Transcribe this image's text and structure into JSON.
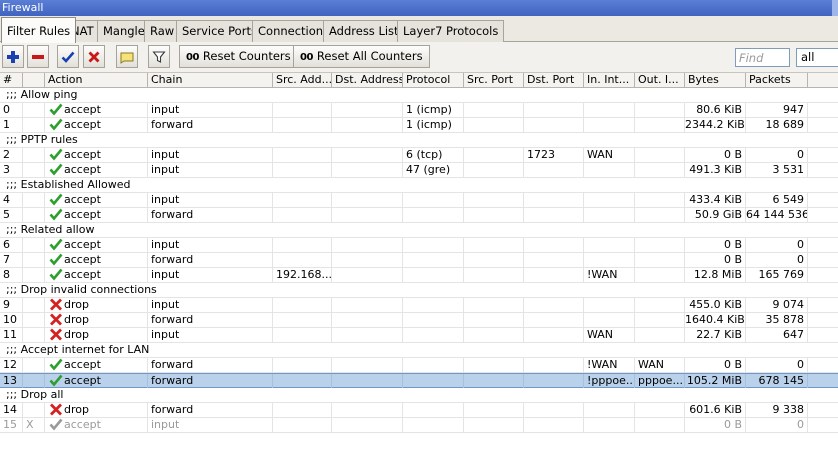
{
  "window": {
    "title": "Firewall"
  },
  "tabs": [
    {
      "label": "Filter Rules",
      "active": true
    },
    {
      "label": "NAT"
    },
    {
      "label": "Mangle"
    },
    {
      "label": "Raw"
    },
    {
      "label": "Service Ports"
    },
    {
      "label": "Connections"
    },
    {
      "label": "Address Lists"
    },
    {
      "label": "Layer7 Protocols"
    }
  ],
  "toolbar": {
    "add_icon": "plus-icon",
    "remove_icon": "minus-icon",
    "enable_icon": "checkmark-icon",
    "disable_icon": "x-icon",
    "comment_icon": "note-icon",
    "filter_icon": "funnel-icon",
    "reset_counters_label": "Reset Counters",
    "reset_all_counters_label": "Reset All Counters",
    "counter_prefix": "00",
    "find_placeholder": "Find",
    "filter_value": "all"
  },
  "columns": [
    "#",
    "",
    "Action",
    "Chain",
    "Src. Add...",
    "Dst. Address",
    "Protocol",
    "Src. Port",
    "Dst. Port",
    "In. Int...",
    "Out. I...",
    "Bytes",
    "Packets"
  ],
  "rows": [
    {
      "type": "comment",
      "text": ";;; Allow ping"
    },
    {
      "type": "rule",
      "num": "0",
      "flag": "",
      "action": "accept",
      "chain": "input",
      "src": "",
      "dst": "",
      "proto": "1 (icmp)",
      "sport": "",
      "dport": "",
      "in": "",
      "out": "",
      "bytes": "80.6 KiB",
      "packets": "947"
    },
    {
      "type": "rule",
      "num": "1",
      "flag": "",
      "action": "accept",
      "chain": "forward",
      "src": "",
      "dst": "",
      "proto": "1 (icmp)",
      "sport": "",
      "dport": "",
      "in": "",
      "out": "",
      "bytes": "2344.2 KiB",
      "packets": "18 689"
    },
    {
      "type": "comment",
      "text": ";;; PPTP rules"
    },
    {
      "type": "rule",
      "num": "2",
      "flag": "",
      "action": "accept",
      "chain": "input",
      "src": "",
      "dst": "",
      "proto": "6 (tcp)",
      "sport": "",
      "dport": "1723",
      "in": "WAN",
      "out": "",
      "bytes": "0 B",
      "packets": "0"
    },
    {
      "type": "rule",
      "num": "3",
      "flag": "",
      "action": "accept",
      "chain": "input",
      "src": "",
      "dst": "",
      "proto": "47 (gre)",
      "sport": "",
      "dport": "",
      "in": "",
      "out": "",
      "bytes": "491.3 KiB",
      "packets": "3 531"
    },
    {
      "type": "comment",
      "text": ";;; Established Allowed"
    },
    {
      "type": "rule",
      "num": "4",
      "flag": "",
      "action": "accept",
      "chain": "input",
      "src": "",
      "dst": "",
      "proto": "",
      "sport": "",
      "dport": "",
      "in": "",
      "out": "",
      "bytes": "433.4 KiB",
      "packets": "6 549"
    },
    {
      "type": "rule",
      "num": "5",
      "flag": "",
      "action": "accept",
      "chain": "forward",
      "src": "",
      "dst": "",
      "proto": "",
      "sport": "",
      "dport": "",
      "in": "",
      "out": "",
      "bytes": "50.9 GiB",
      "packets": "64 144 536"
    },
    {
      "type": "comment",
      "text": ";;; Related allow"
    },
    {
      "type": "rule",
      "num": "6",
      "flag": "",
      "action": "accept",
      "chain": "input",
      "src": "",
      "dst": "",
      "proto": "",
      "sport": "",
      "dport": "",
      "in": "",
      "out": "",
      "bytes": "0 B",
      "packets": "0"
    },
    {
      "type": "rule",
      "num": "7",
      "flag": "",
      "action": "accept",
      "chain": "forward",
      "src": "",
      "dst": "",
      "proto": "",
      "sport": "",
      "dport": "",
      "in": "",
      "out": "",
      "bytes": "0 B",
      "packets": "0"
    },
    {
      "type": "rule",
      "num": "8",
      "flag": "",
      "action": "accept",
      "chain": "input",
      "src": "192.168...",
      "dst": "",
      "proto": "",
      "sport": "",
      "dport": "",
      "in": "!WAN",
      "out": "",
      "bytes": "12.8 MiB",
      "packets": "165 769"
    },
    {
      "type": "comment",
      "text": ";;; Drop invalid connections"
    },
    {
      "type": "rule",
      "num": "9",
      "flag": "",
      "action": "drop",
      "chain": "input",
      "src": "",
      "dst": "",
      "proto": "",
      "sport": "",
      "dport": "",
      "in": "",
      "out": "",
      "bytes": "455.0 KiB",
      "packets": "9 074"
    },
    {
      "type": "rule",
      "num": "10",
      "flag": "",
      "action": "drop",
      "chain": "forward",
      "src": "",
      "dst": "",
      "proto": "",
      "sport": "",
      "dport": "",
      "in": "",
      "out": "",
      "bytes": "1640.4 KiB",
      "packets": "35 878"
    },
    {
      "type": "rule",
      "num": "11",
      "flag": "",
      "action": "drop",
      "chain": "input",
      "src": "",
      "dst": "",
      "proto": "",
      "sport": "",
      "dport": "",
      "in": "WAN",
      "out": "",
      "bytes": "22.7 KiB",
      "packets": "647"
    },
    {
      "type": "comment",
      "text": ";;; Accept internet for LAN"
    },
    {
      "type": "rule",
      "num": "12",
      "flag": "",
      "action": "accept",
      "chain": "forward",
      "src": "",
      "dst": "",
      "proto": "",
      "sport": "",
      "dport": "",
      "in": "!WAN",
      "out": "WAN",
      "bytes": "0 B",
      "packets": "0"
    },
    {
      "type": "rule",
      "num": "13",
      "flag": "",
      "action": "accept",
      "chain": "forward",
      "src": "",
      "dst": "",
      "proto": "",
      "sport": "",
      "dport": "",
      "in": "!pppoe...",
      "out": "pppoe...",
      "bytes": "105.2 MiB",
      "packets": "678 145",
      "selected": true
    },
    {
      "type": "comment",
      "text": ";;; Drop all"
    },
    {
      "type": "rule",
      "num": "14",
      "flag": "",
      "action": "drop",
      "chain": "forward",
      "src": "",
      "dst": "",
      "proto": "",
      "sport": "",
      "dport": "",
      "in": "",
      "out": "",
      "bytes": "601.6 KiB",
      "packets": "9 338"
    },
    {
      "type": "rule",
      "num": "15",
      "flag": "X",
      "action": "accept",
      "chain": "input",
      "src": "",
      "dst": "",
      "proto": "",
      "sport": "",
      "dport": "",
      "in": "",
      "out": "",
      "bytes": "0 B",
      "packets": "0",
      "disabled": true
    }
  ],
  "colors": {
    "accept": "#2e9e2e",
    "drop": "#d42020",
    "disabled": "#9a9a9a",
    "selected_row": "#b9d1ea",
    "titlebar": "#4a6fcc"
  }
}
